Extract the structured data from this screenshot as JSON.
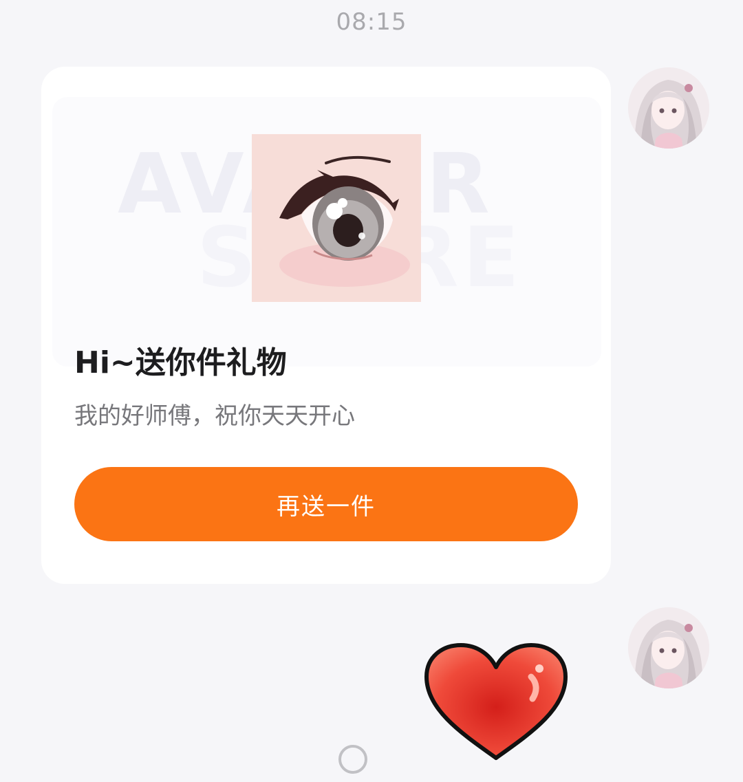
{
  "chat": {
    "timestamp": "08:15"
  },
  "gift_card": {
    "banner_watermark_line1": "AVATAR",
    "banner_watermark_line2": "STORE",
    "title": "Hi~送你件礼物",
    "message": "我的好师傅，祝你天天开心",
    "resend_label": "再送一件"
  },
  "colors": {
    "button_accent": "#fb7414",
    "background": "#f6f6f9",
    "card": "#ffffff",
    "heart": "#e8392b"
  },
  "icons": {
    "gift_image": "anime-eye-icon",
    "sticker": "heart-icon",
    "home": "home-indicator-icon"
  }
}
